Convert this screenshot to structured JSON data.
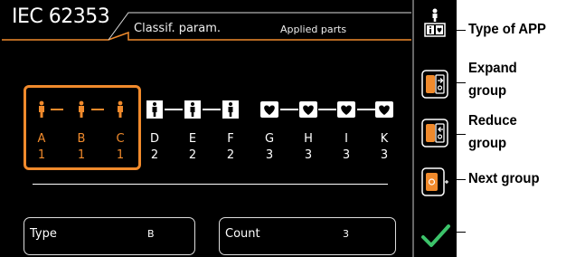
{
  "header": {
    "title": "IEC 62353",
    "tab_label": "Classif. param.",
    "subtitle": "Applied parts"
  },
  "colors": {
    "accent": "#f08a2c",
    "background": "#000000",
    "check": "#3cc36a"
  },
  "groups": [
    {
      "id": "A",
      "number": "1",
      "icon": "person-icon",
      "selected": true
    },
    {
      "id": "B",
      "number": "1",
      "icon": "person-icon",
      "selected": true
    },
    {
      "id": "C",
      "number": "1",
      "icon": "person-icon",
      "selected": true
    },
    {
      "id": "D",
      "number": "2",
      "icon": "person-box-icon",
      "selected": false
    },
    {
      "id": "E",
      "number": "2",
      "icon": "person-box-icon",
      "selected": false
    },
    {
      "id": "F",
      "number": "2",
      "icon": "person-box-icon",
      "selected": false
    },
    {
      "id": "G",
      "number": "3",
      "icon": "heart-box-icon",
      "selected": false
    },
    {
      "id": "H",
      "number": "3",
      "icon": "heart-box-icon",
      "selected": false
    },
    {
      "id": "I",
      "number": "3",
      "icon": "heart-box-icon",
      "selected": false
    },
    {
      "id": "K",
      "number": "3",
      "icon": "heart-box-icon",
      "selected": false
    }
  ],
  "fields": {
    "type_label": "Type",
    "type_value": "B",
    "count_label": "Count",
    "count_value": "3"
  },
  "sidebar": {
    "buttons": [
      {
        "name": "type-of-app-button",
        "icon": "app-type-icon"
      },
      {
        "name": "expand-group-button",
        "icon": "expand-group-icon"
      },
      {
        "name": "reduce-group-button",
        "icon": "reduce-group-icon"
      },
      {
        "name": "next-group-button",
        "icon": "next-group-icon"
      }
    ],
    "confirm_icon": "check-icon"
  },
  "annotations": {
    "type_of_app": "Type of APP",
    "expand_1": "Expand",
    "expand_2": "group",
    "reduce_1": "Reduce",
    "reduce_2": "group",
    "next_group": "Next group"
  }
}
